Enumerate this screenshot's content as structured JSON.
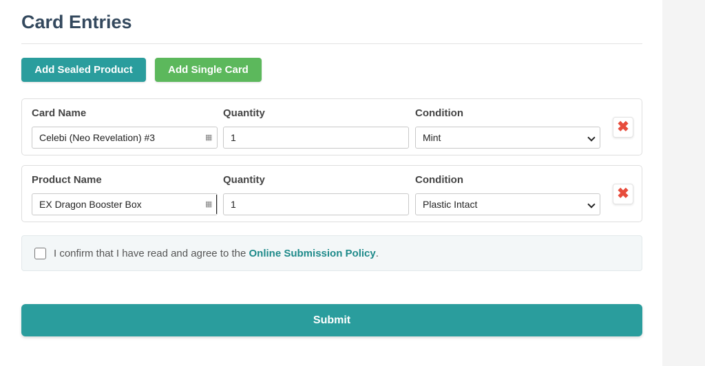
{
  "header": {
    "title": "Card Entries"
  },
  "actions": {
    "add_sealed_label": "Add Sealed Product",
    "add_single_label": "Add Single Card"
  },
  "entries": [
    {
      "name_label": "Card Name",
      "name_value": "Celebi (Neo Revelation) #3",
      "quantity_label": "Quantity",
      "quantity_value": "1",
      "condition_label": "Condition",
      "condition_value": "Mint",
      "remove_icon": "close-icon"
    },
    {
      "name_label": "Product Name",
      "name_value": "EX Dragon Booster Box",
      "quantity_label": "Quantity",
      "quantity_value": "1",
      "condition_label": "Condition",
      "condition_value": "Plastic Intact",
      "remove_icon": "close-icon"
    }
  ],
  "policy": {
    "text_before": "I confirm that I have read and agree to the ",
    "link_text": "Online Submission Policy",
    "text_after": ".",
    "checked": false
  },
  "submit": {
    "label": "Submit"
  },
  "colors": {
    "primary": "#2a9d9d",
    "success": "#5cb85c",
    "danger": "#e74c3c",
    "title": "#34495e"
  }
}
